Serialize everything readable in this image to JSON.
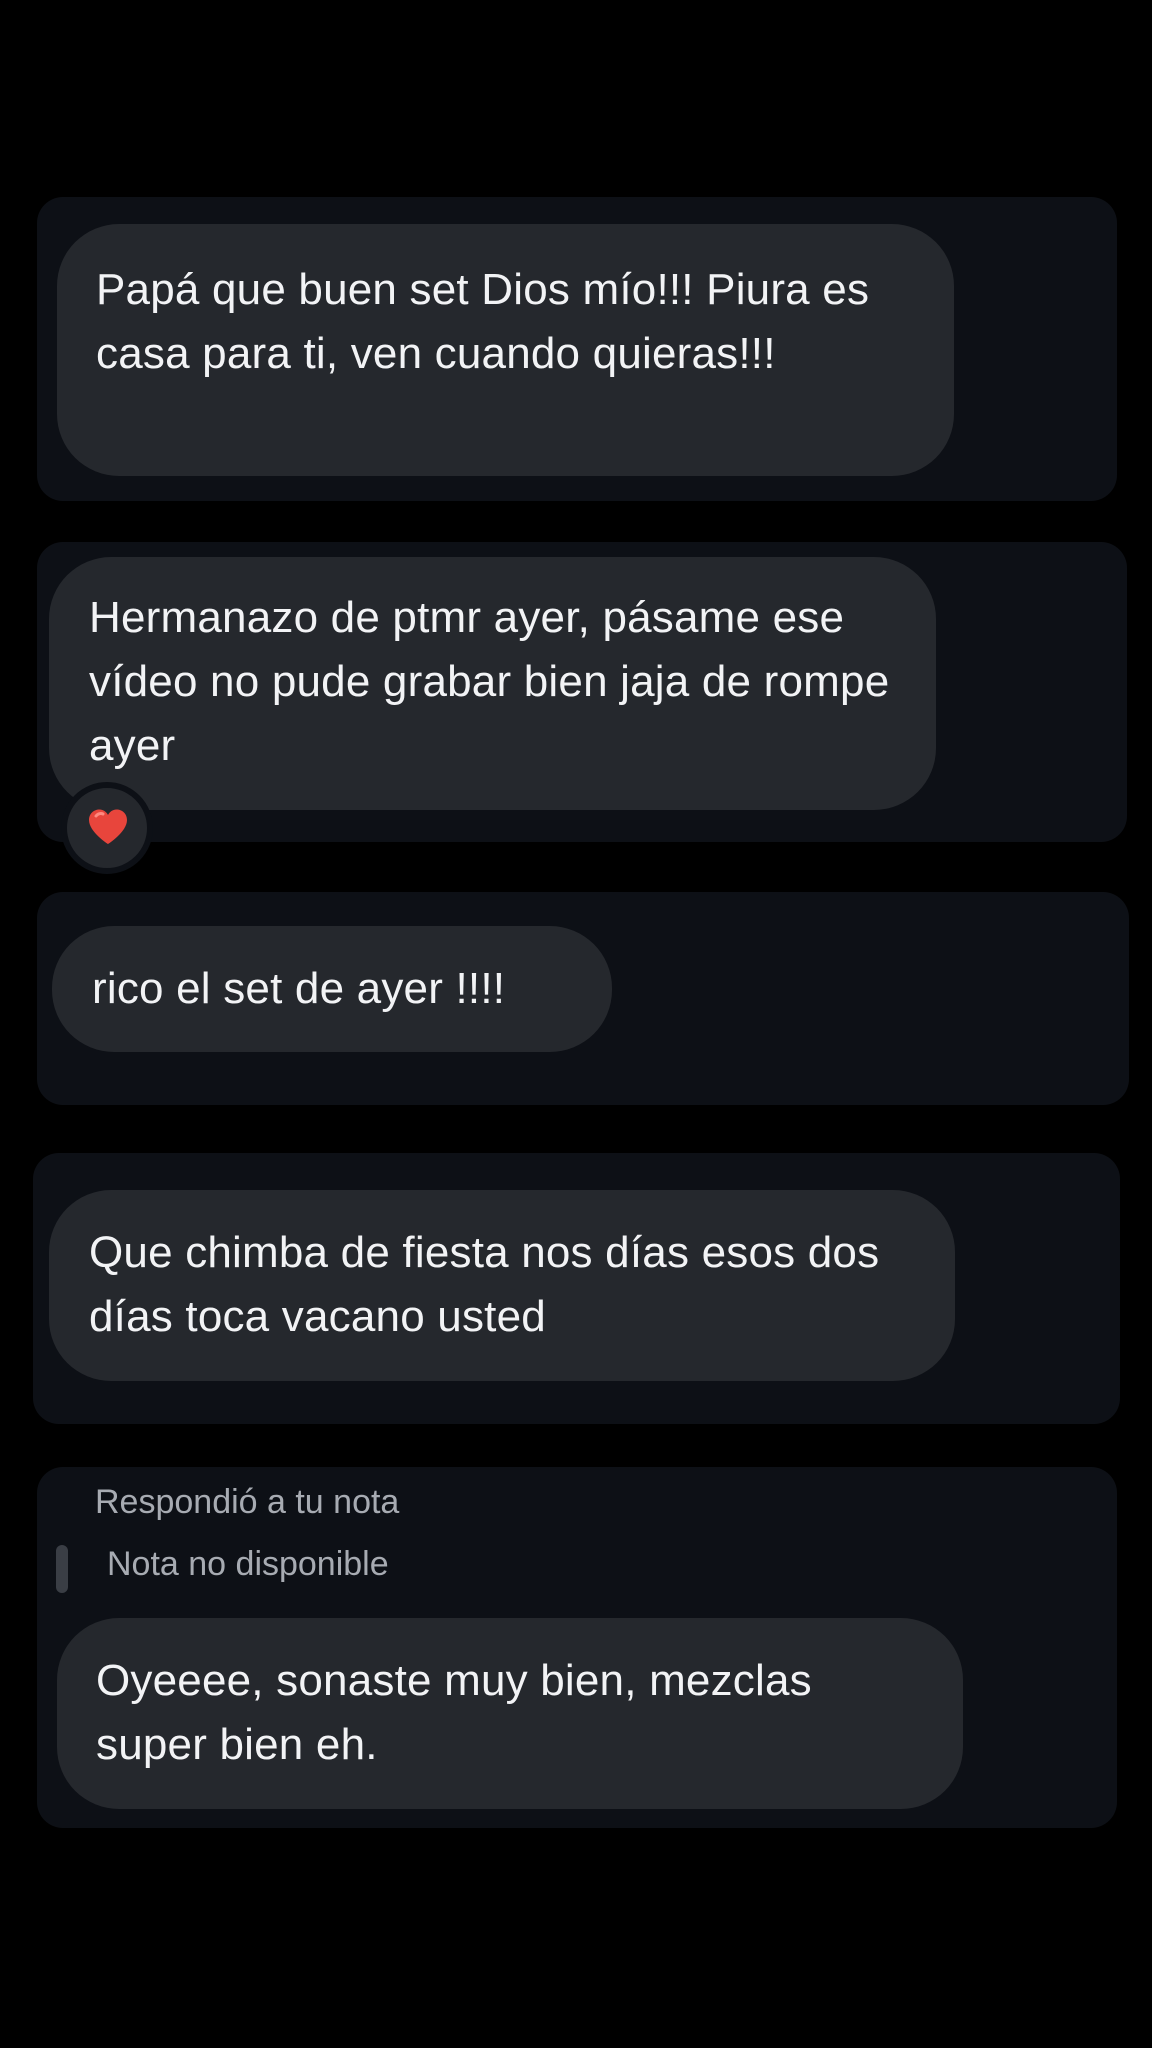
{
  "conversation": {
    "messages": [
      {
        "text": "Papá que buen set Dios mío!!! Piura es casa para ti, ven cuando quieras!!!"
      },
      {
        "text": "Hermanazo de ptmr ayer, pásame ese vídeo no pude grabar bien jaja de rompe ayer",
        "reaction": "heart-emoji"
      },
      {
        "text": "rico el set de ayer !!!!"
      },
      {
        "text": "Que chimba de fiesta nos días esos dos días toca vacano usted"
      },
      {
        "reply_label": "Respondió a tu nota",
        "quoted_note": "Nota no disponible",
        "text": "Oyeeee, sonaste muy bien, mezclas super bien eh."
      }
    ]
  },
  "colors": {
    "background": "#000000",
    "card": "#0d1016",
    "bubble": "#25282d",
    "text": "#f2f3f5",
    "secondary_text": "#a7abb2",
    "reaction_heart": "#e8453c"
  }
}
